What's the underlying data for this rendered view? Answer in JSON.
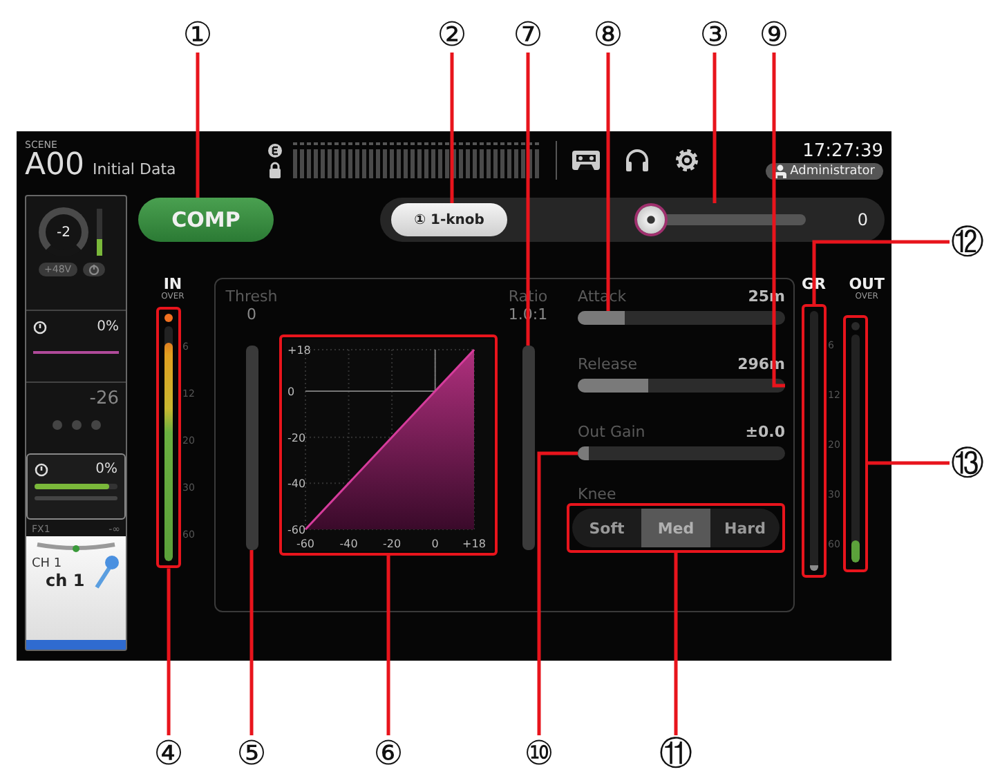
{
  "callouts": [
    {
      "label": "①"
    },
    {
      "label": "②"
    },
    {
      "label": "⑦"
    },
    {
      "label": "⑧"
    },
    {
      "label": "③"
    },
    {
      "label": "⑨"
    },
    {
      "label": "⑫"
    },
    {
      "label": "⑬"
    },
    {
      "label": "④"
    },
    {
      "label": "⑤"
    },
    {
      "label": "⑥"
    },
    {
      "label": "⑩"
    },
    {
      "label": "⑪"
    }
  ],
  "header": {
    "scene_label": "SCENE",
    "scene_number": "A00",
    "scene_name": "Initial Data",
    "time": "17:27:39",
    "user": "Administrator"
  },
  "channel_strip": {
    "gain": "-2",
    "input_meter": {
      "level": 0.35
    },
    "phantom": "+48V",
    "send_1": "0%",
    "level": "-26",
    "send_2": "0%",
    "send_2_meter": {
      "level": 0.9
    },
    "fx_label": "FX1",
    "fx_value": "-∞",
    "channel_id": "CH 1",
    "channel_name": "ch 1"
  },
  "comp_button": {
    "label": "COMP",
    "on": true
  },
  "one_knob": {
    "badge": "①",
    "label": "1-knob",
    "level": 0,
    "value": "0"
  },
  "in_meter": {
    "label": "IN",
    "over_label": "OVER",
    "over": true,
    "level": 0.93,
    "scale": [
      "6",
      "12",
      "20",
      "30",
      "60"
    ]
  },
  "threshold": {
    "label": "Thresh",
    "value": "0"
  },
  "ratio": {
    "label": "Ratio",
    "value": "1.0:1"
  },
  "transfer_graph": {
    "chart_data": {
      "type": "area",
      "grid": true,
      "x": [
        -60,
        18
      ],
      "series": [
        {
          "color": "#d63c9c",
          "values": [
            -60,
            18
          ]
        }
      ],
      "xlim": [
        -60,
        18
      ],
      "ylim": [
        -60,
        18
      ],
      "xticks": [
        -60,
        -40,
        -20,
        0,
        {
          "value": 18,
          "label": "+18"
        }
      ],
      "yticks": [
        {
          "value": 18,
          "label": "+18"
        },
        0,
        -20,
        -40,
        -60
      ]
    }
  },
  "params": [
    {
      "label": "Attack",
      "value": "25m",
      "level": 0.18
    },
    {
      "label": "Release",
      "value": "296m",
      "level": 0.3
    },
    {
      "label": "Out Gain",
      "value": "±0.0",
      "level": 0
    }
  ],
  "knee": {
    "label": "Knee",
    "options": [
      {
        "label": "Soft",
        "selected": false
      },
      {
        "label": "Med",
        "selected": true
      },
      {
        "label": "Hard",
        "selected": false
      }
    ]
  },
  "gr_meter": {
    "label": "GR",
    "level": 0,
    "scale": [
      "6",
      "12",
      "20",
      "30",
      "60"
    ]
  },
  "out_meter": {
    "label": "OUT",
    "over_label": "OVER",
    "over": false,
    "level": 0.1
  }
}
